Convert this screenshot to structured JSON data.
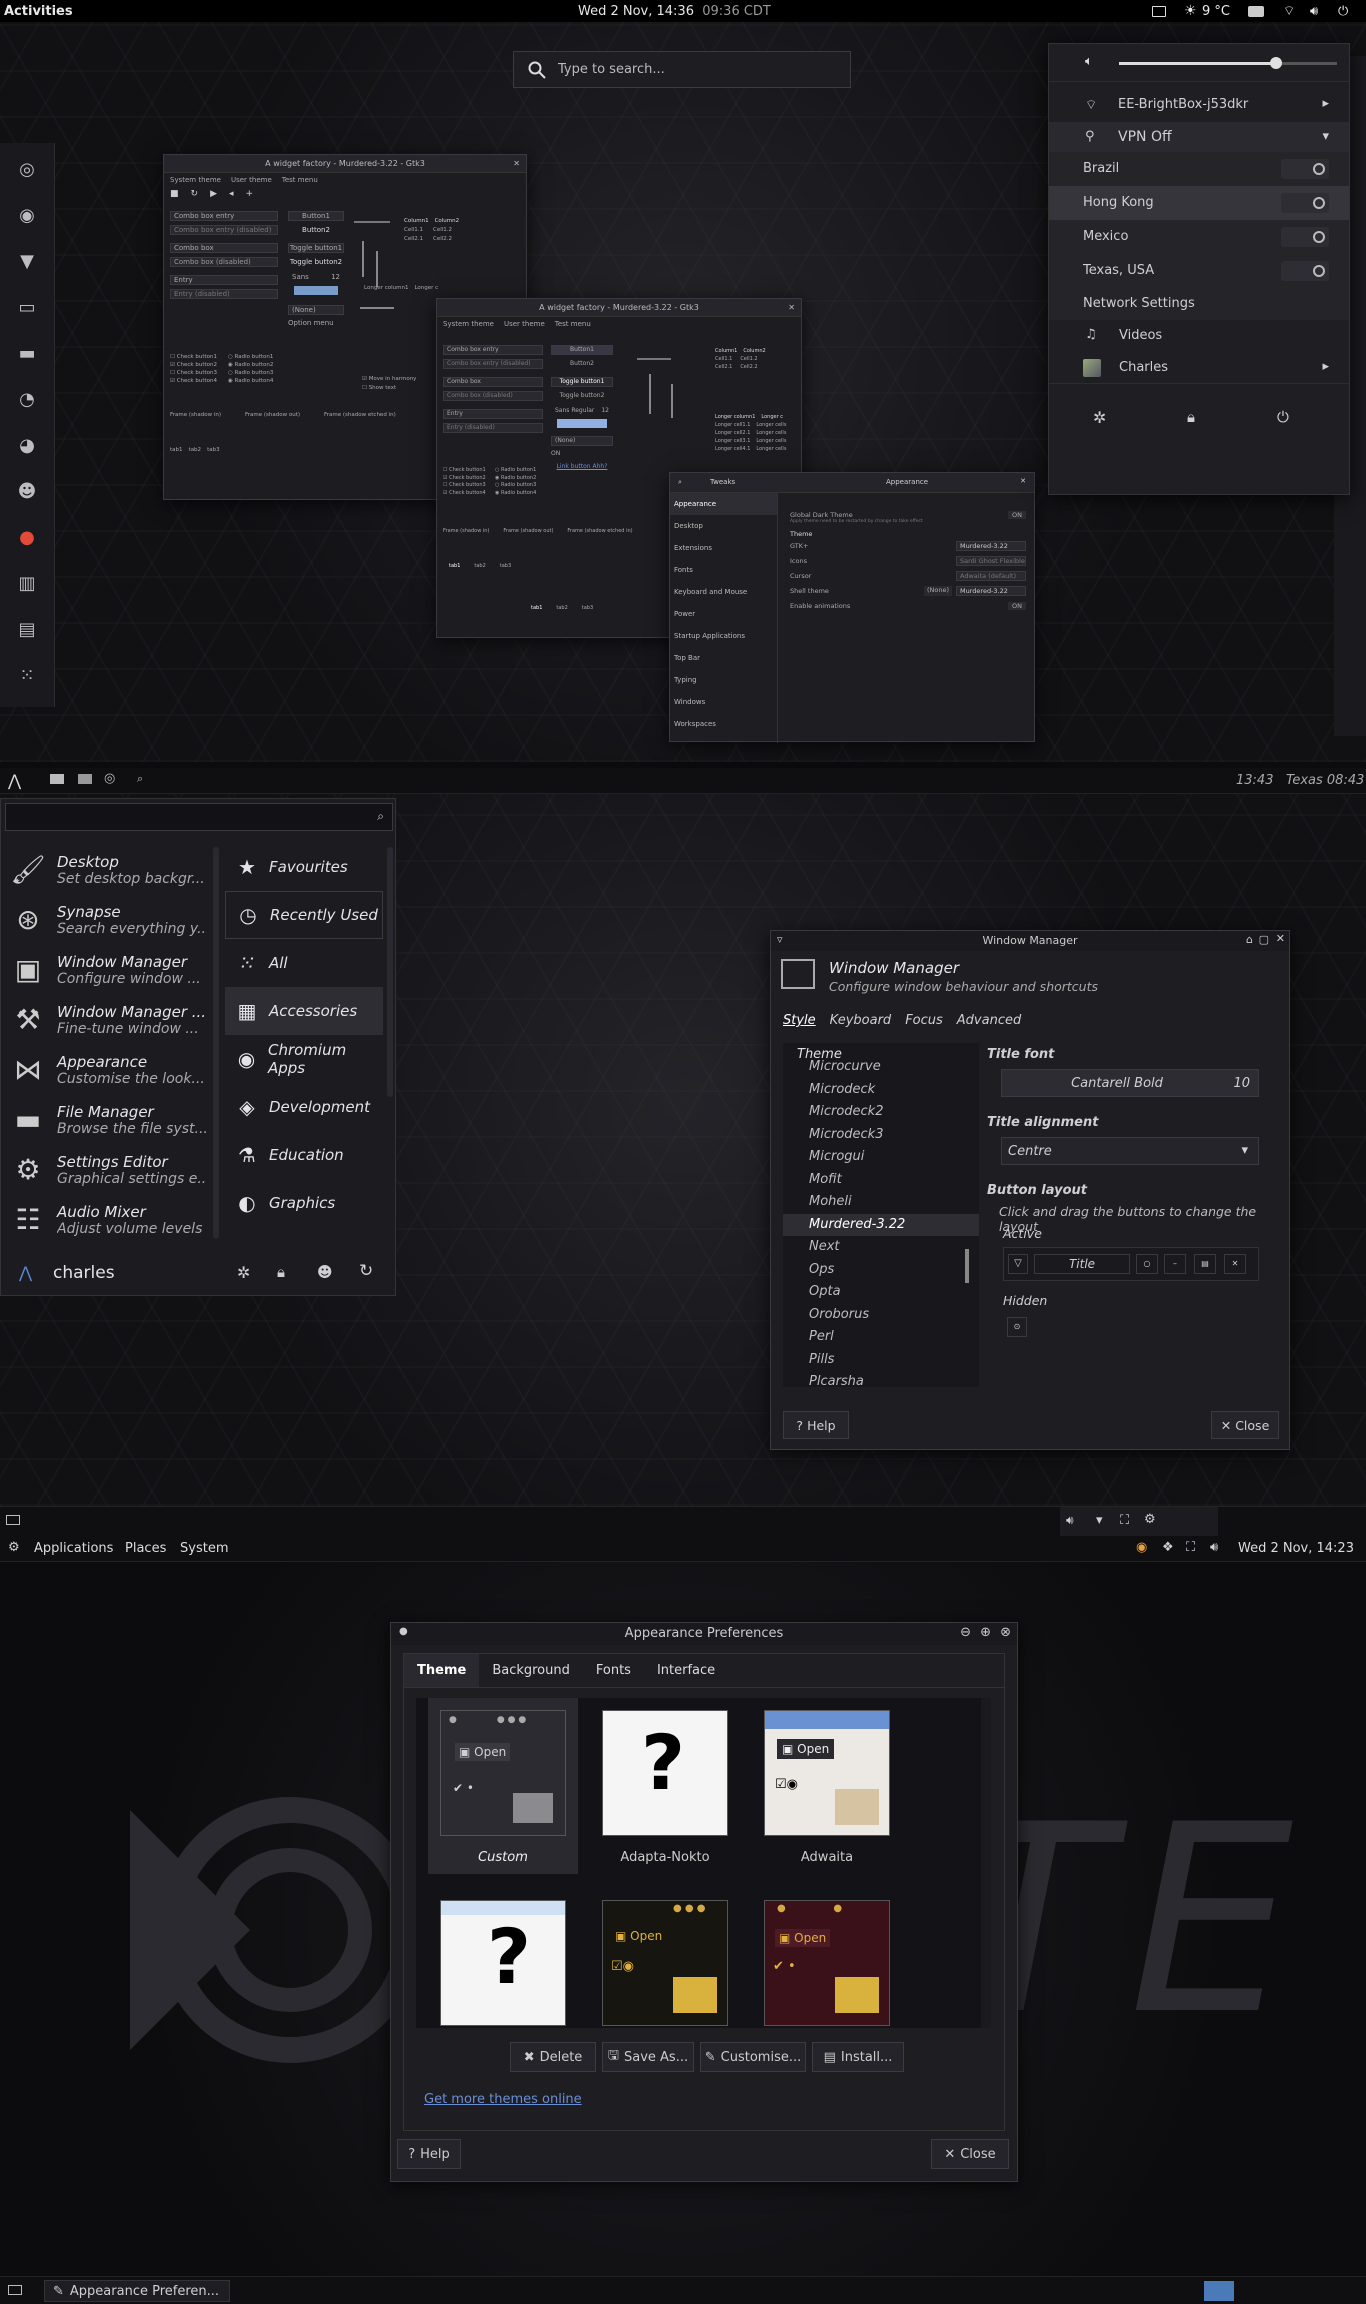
{
  "gnome": {
    "activities": "Activities",
    "clock": "Wed  2 Nov, 14:36",
    "clock_secondary": "09:36 CDT",
    "weather": "9 °C",
    "search_placeholder": "Type to search...",
    "menu": {
      "wifi": "EE-BrightBox-j53dkr",
      "vpn": "VPN Off",
      "vpn_items": [
        "Brazil",
        "Hong Kong",
        "Mexico",
        "Texas, USA"
      ],
      "network_settings": "Network Settings",
      "videos": "Videos",
      "user": "Charles",
      "volume_level": 0.72
    },
    "dock_icons": [
      "chromium-icon",
      "chrome-icon",
      "brave-icon",
      "terminal-icon",
      "files-icon",
      "toggle-icon",
      "firefox-icon",
      "gimp-icon",
      "reddit-icon",
      "equalizer-icon",
      "video-icon",
      "apps-grid-icon"
    ],
    "widget_factory": {
      "title": "A widget factory - Murdered-3.22 - Gtk3",
      "menubar": [
        "System theme",
        "User theme",
        "Test menu"
      ],
      "combo_entry": "Combo box entry",
      "combo_entry_disabled": "Combo box entry (disabled)",
      "combo": "Combo box",
      "combo_disabled": "Combo box (disabled)",
      "entry": "Entry",
      "entry_disabled": "Entry (disabled)",
      "button1": "Button1",
      "button2": "Button2",
      "toggle1": "Toggle button1",
      "toggle2": "Toggle button2",
      "sans": "Sans",
      "sans_size": "12",
      "none": "(None)",
      "option_menu": "Option menu",
      "checks": [
        "Check button1",
        "Check button2",
        "Check button3",
        "Check button4"
      ],
      "radios": [
        "Radio button1",
        "Radio button2",
        "Radio button3",
        "Radio button4"
      ],
      "move_harmony": "Move in harmony",
      "show_text": "Show text",
      "frames": [
        "Frame (shadow in)",
        "Frame (shadow out)",
        "Frame (shadow etched in)"
      ],
      "columns": [
        "Column1",
        "Column2"
      ],
      "cells": [
        "Cell1.1",
        "Cell1.2",
        "Cell2.1",
        "Cell2.2"
      ],
      "longer": [
        "Longer column1",
        "Longer c"
      ],
      "tabs": [
        "tab1",
        "tab2",
        "tab3"
      ],
      "sans_regular": "Sans Regular",
      "link": "Link button Ahh?",
      "on": "ON",
      "longer_cells": [
        "Longer cell1.1",
        "Longer cell2.1",
        "Longer cell3.1",
        "Longer cell4.1"
      ],
      "longer_cells2": [
        "Longer cells",
        "Longer cells",
        "Longer cells",
        "Longer cells"
      ]
    },
    "tweaks": {
      "title": "Tweaks",
      "panel_title": "Appearance",
      "sidebar": [
        "Appearance",
        "Desktop",
        "Extensions",
        "Fonts",
        "Keyboard and Mouse",
        "Power",
        "Startup Applications",
        "Top Bar",
        "Typing",
        "Windows",
        "Workspaces"
      ],
      "global_dark": "Global Dark Theme",
      "global_dark_note": "Apply theme need to be restarted by change to take effect",
      "theme_header": "Theme",
      "rows": [
        {
          "label": "GTK+",
          "value": "Murdered-3.22"
        },
        {
          "label": "Icons",
          "value": "Sardi Ghost Flexible"
        },
        {
          "label": "Cursor",
          "value": "Adwaita (default)"
        },
        {
          "label": "Shell theme",
          "value": "Murdered-3.22"
        }
      ],
      "shell_none": "(None)",
      "enable_animations": "Enable animations",
      "on": "ON"
    }
  },
  "xfce": {
    "clock": "13:43",
    "clock2": "Texas 08:43",
    "menu_items": [
      {
        "title": "Desktop",
        "sub": "Set desktop backgr...",
        "icon": "brush-icon"
      },
      {
        "title": "Synapse",
        "sub": "Search everything y...",
        "icon": "synapse-icon"
      },
      {
        "title": "Window Manager",
        "sub": "Configure window ...",
        "icon": "window-icon"
      },
      {
        "title": "Window Manager ...",
        "sub": "Fine-tune window ...",
        "icon": "tools-icon"
      },
      {
        "title": "Appearance",
        "sub": "Customise the look...",
        "icon": "bowtie-icon"
      },
      {
        "title": "File Manager",
        "sub": "Browse the file syst...",
        "icon": "folder-icon"
      },
      {
        "title": "Settings Editor",
        "sub": "Graphical settings e...",
        "icon": "settings-editor-icon"
      },
      {
        "title": "Audio Mixer",
        "sub": "Adjust volume levels",
        "icon": "mixer-icon"
      }
    ],
    "categories": [
      "Favourites",
      "Recently Used",
      "All",
      "Accessories",
      "Chromium Apps",
      "Development",
      "Education",
      "Graphics"
    ],
    "user": "charles",
    "wm": {
      "title": "Window Manager",
      "header": "Window Manager",
      "subheader": "Configure window behaviour and shortcuts",
      "tabs": [
        "Style",
        "Keyboard",
        "Focus",
        "Advanced"
      ],
      "theme_label": "Theme",
      "themes": [
        "Microcurve",
        "Microdeck",
        "Microdeck2",
        "Microdeck3",
        "Microgui",
        "Mofit",
        "Moheli",
        "Murdered-3.22",
        "Next",
        "Ops",
        "Opta",
        "Oroborus",
        "Perl",
        "Pills",
        "Plcarsha"
      ],
      "selected_theme": "Murdered-3.22",
      "title_font_label": "Title font",
      "font": "Cantarell Bold",
      "font_size": "10",
      "title_align_label": "Title alignment",
      "align": "Centre",
      "button_layout_label": "Button layout",
      "button_layout_hint": "Click and drag the buttons to change the layout",
      "active": "Active",
      "title_btn": "Title",
      "hidden": "Hidden",
      "help": "Help",
      "close": "Close"
    }
  },
  "mate": {
    "menu": [
      "Applications",
      "Places",
      "System"
    ],
    "clock": "Wed  2 Nov, 14:23",
    "taskbar_item": "Appearance Preferen...",
    "background_text": "TE",
    "ap": {
      "title": "Appearance Preferences",
      "tabs": [
        "Theme",
        "Background",
        "Fonts",
        "Interface"
      ],
      "themes": [
        "Custom",
        "Adapta-Nokto",
        "Adwaita",
        "",
        "",
        ""
      ],
      "open": "Open",
      "delete": "Delete",
      "save_as": "Save As...",
      "customise": "Customise...",
      "install": "Install...",
      "more": "Get more themes online",
      "help": "Help",
      "close": "Close"
    }
  }
}
